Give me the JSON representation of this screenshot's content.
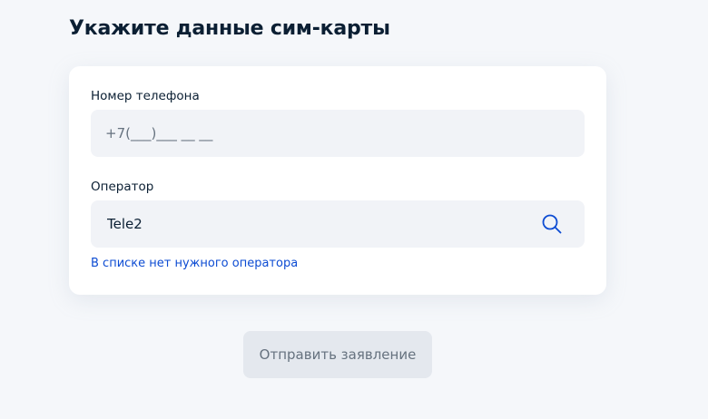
{
  "page": {
    "title": "Укажите данные сим-карты"
  },
  "form": {
    "phone": {
      "label": "Номер телефона",
      "placeholder": "+7(___)___ __ __",
      "value": ""
    },
    "operator": {
      "label": "Оператор",
      "value": "Tele2",
      "search_icon": "search-icon"
    },
    "missing_operator_link": "В списке нет нужного оператора"
  },
  "actions": {
    "submit_label": "Отправить заявление",
    "submit_state": "disabled"
  },
  "colors": {
    "page_background": "#f5f7fa",
    "card_background": "#ffffff",
    "input_background": "#f1f3f7",
    "link": "#0d4cd3",
    "icon": "#0d4cd3",
    "button_disabled_background": "#e4e8ee",
    "button_disabled_text": "#66727f",
    "text_primary": "#0b1f33"
  }
}
